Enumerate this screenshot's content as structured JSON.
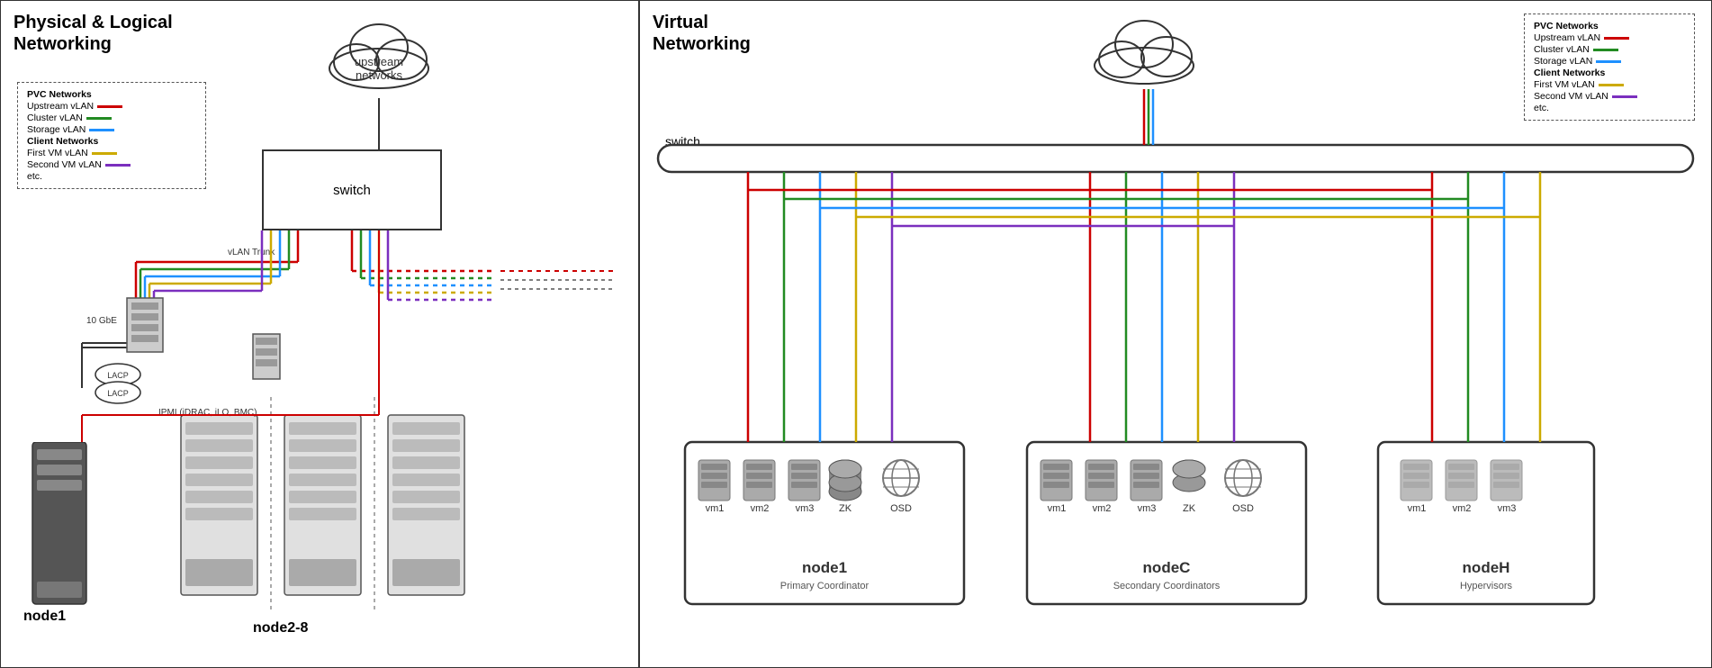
{
  "left_panel": {
    "title": "Physical & Logical\nNetworking",
    "legend": {
      "pvc_networks_label": "PVC Networks",
      "items": [
        {
          "label": "Upstream vLAN",
          "color": "#cc0000"
        },
        {
          "label": "Cluster vLAN",
          "color": "#228b22"
        },
        {
          "label": "Storage vLAN",
          "color": "#1e90ff"
        },
        {
          "label": "Client Networks",
          "bold": true
        },
        {
          "label": "First VM vLAN",
          "color": "#ccaa00"
        },
        {
          "label": "Second VM vLAN",
          "color": "#7b2fbe"
        },
        {
          "label": "etc.",
          "no_line": true
        }
      ]
    },
    "cloud_label": "upstream\nnetworks",
    "switch_label": "switch",
    "vlan_trunk_label": "vLAN Trunk",
    "gbe_label": "10 GbE",
    "ipmi_label": "IPMI (iDRAC, iLO, BMC)",
    "node1_label": "node1",
    "node2_8_label": "node2-8",
    "lacp_label": "LACP"
  },
  "right_panel": {
    "title": "Virtual\nNetworking",
    "legend": {
      "pvc_networks_label": "PVC Networks",
      "items": [
        {
          "label": "Upstream vLAN",
          "color": "#cc0000"
        },
        {
          "label": "Cluster vLAN",
          "color": "#228b22"
        },
        {
          "label": "Storage vLAN",
          "color": "#1e90ff"
        },
        {
          "label": "Client Networks",
          "bold": true
        },
        {
          "label": "First VM vLAN",
          "color": "#ccaa00"
        },
        {
          "label": "Second VM vLAN",
          "color": "#7b2fbe"
        },
        {
          "label": "etc.",
          "no_line": true
        }
      ]
    },
    "switch_label": "switch",
    "node1": {
      "label": "node1",
      "sublabel": "Primary Coordinator",
      "vms": [
        "vm1",
        "vm2",
        "vm3",
        "ZK",
        "OSD"
      ]
    },
    "nodeC": {
      "label": "nodeC",
      "sublabel": "Secondary Coordinators",
      "vms": [
        "vm1",
        "vm2",
        "vm3",
        "ZK",
        "OSD"
      ]
    },
    "nodeH": {
      "label": "nodeH",
      "sublabel": "Hypervisors",
      "vms": [
        "vm1",
        "vm2",
        "vm3"
      ]
    }
  },
  "colors": {
    "upstream": "#cc0000",
    "cluster": "#228b22",
    "storage": "#1e90ff",
    "first_vm": "#ccaa00",
    "second_vm": "#7b2fbe"
  }
}
